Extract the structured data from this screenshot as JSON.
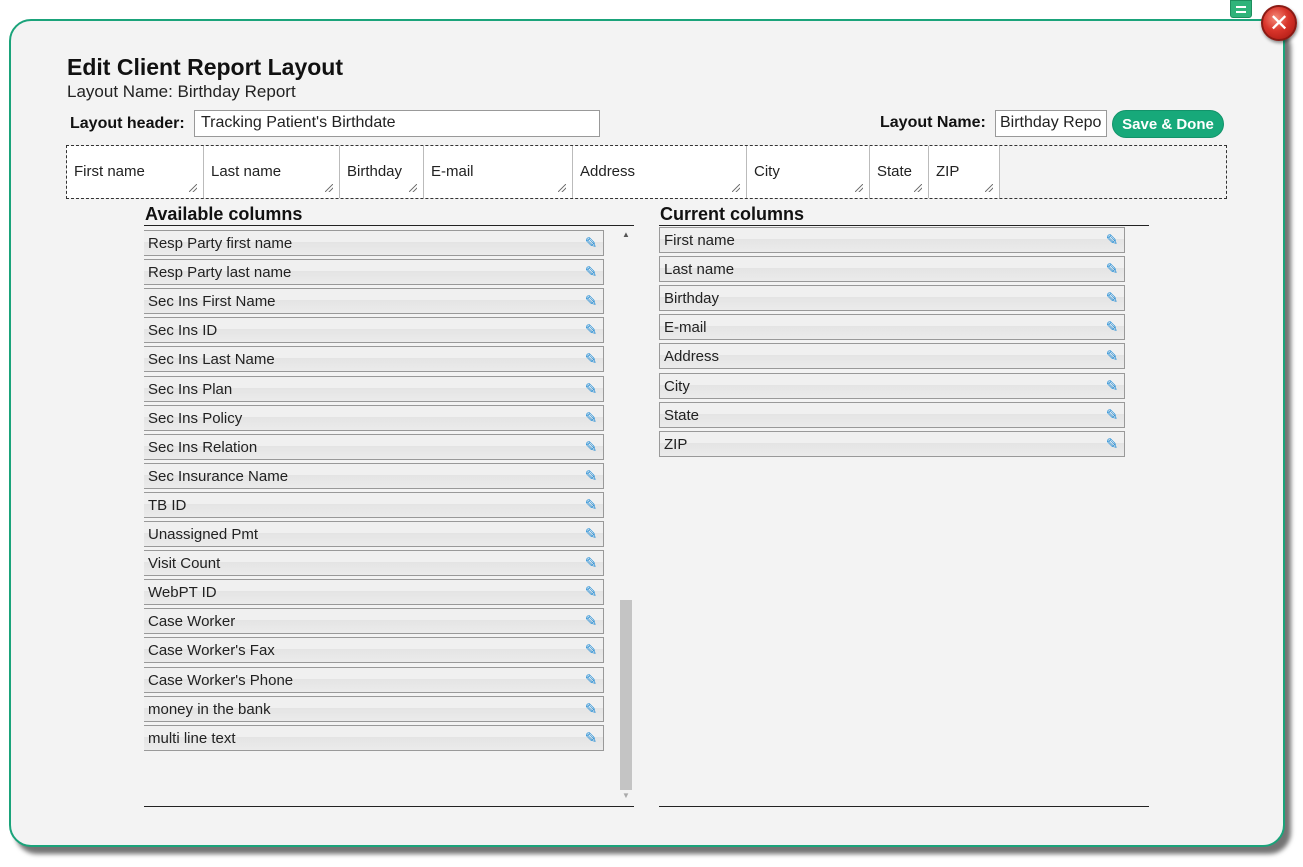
{
  "dialog": {
    "title": "Edit Client Report Layout",
    "subtitle": "Layout Name: Birthday Report",
    "close_icon": "close-icon",
    "top_icon": "list-icon"
  },
  "form": {
    "layout_header_label": "Layout header:",
    "layout_header_value": "Tracking Patient's Birthdate",
    "layout_name_label": "Layout Name:",
    "layout_name_value": "Birthday Repo",
    "save_label": "Save & Done"
  },
  "preview_columns": [
    "First name",
    "Last name",
    "Birthday",
    "E-mail",
    "Address",
    "City",
    "State",
    "ZIP"
  ],
  "available": {
    "title": "Available columns",
    "items": [
      "Resp Party first name",
      "Resp Party last name",
      "Sec Ins First Name",
      "Sec Ins ID",
      "Sec Ins Last Name",
      "Sec Ins Plan",
      "Sec Ins Policy",
      "Sec Ins Relation",
      "Sec Insurance Name",
      "TB ID",
      "Unassigned Pmt",
      "Visit Count",
      "WebPT ID",
      "Case Worker",
      "Case Worker's Fax",
      "Case Worker's Phone",
      "money in the bank",
      "multi line text"
    ]
  },
  "current": {
    "title": "Current columns",
    "items": [
      "First name",
      "Last name",
      "Birthday",
      "E-mail",
      "Address",
      "City",
      "State",
      "ZIP"
    ]
  },
  "colors": {
    "accent": "#17a97a",
    "border": "#1aa37a",
    "close": "#d8342a",
    "pencil": "#1e8bd6"
  }
}
